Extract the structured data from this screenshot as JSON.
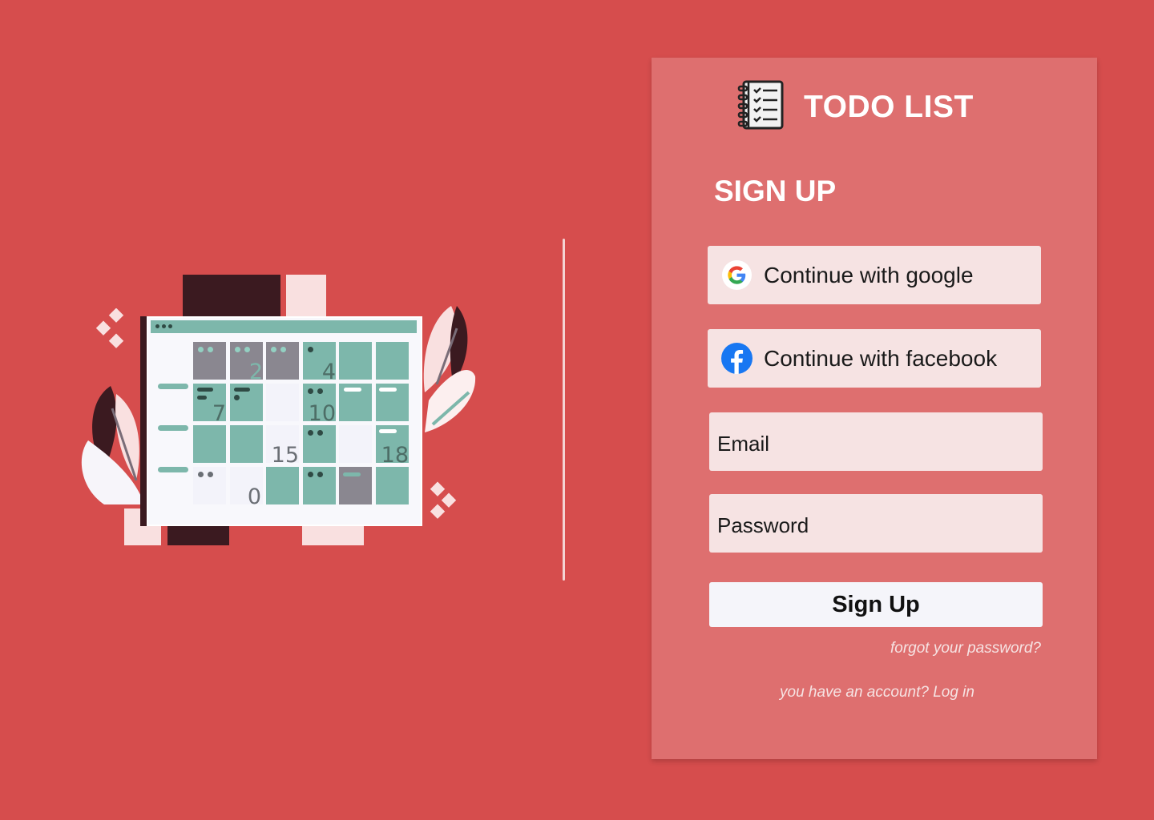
{
  "app": {
    "title": "TODO LIST",
    "icon": "notebook-checklist-icon"
  },
  "page": {
    "heading": "SIGN UP"
  },
  "social": {
    "google": {
      "label": "Continue with google",
      "icon": "google-icon"
    },
    "facebook": {
      "label": "Continue with facebook",
      "icon": "facebook-icon"
    }
  },
  "form": {
    "email_placeholder": "Email",
    "email_value": "",
    "password_placeholder": "Password",
    "password_value": "",
    "submit_label": "Sign Up"
  },
  "links": {
    "forgot_password": "forgot your password?",
    "login_prompt": "you have an account? Log in"
  },
  "illustration": {
    "calendar_numbers": [
      "2",
      "4",
      "7",
      "10",
      "15",
      "18",
      "0"
    ]
  },
  "colors": {
    "background": "#d64d4d",
    "card": "#de6f6f",
    "input_bg": "#f6e3e3",
    "button_bg": "#f5f5fa",
    "calendar_teal": "#7db7ab",
    "calendar_gray": "#8a8790",
    "dark_accent": "#3b1a20",
    "facebook_blue": "#1877f2"
  }
}
